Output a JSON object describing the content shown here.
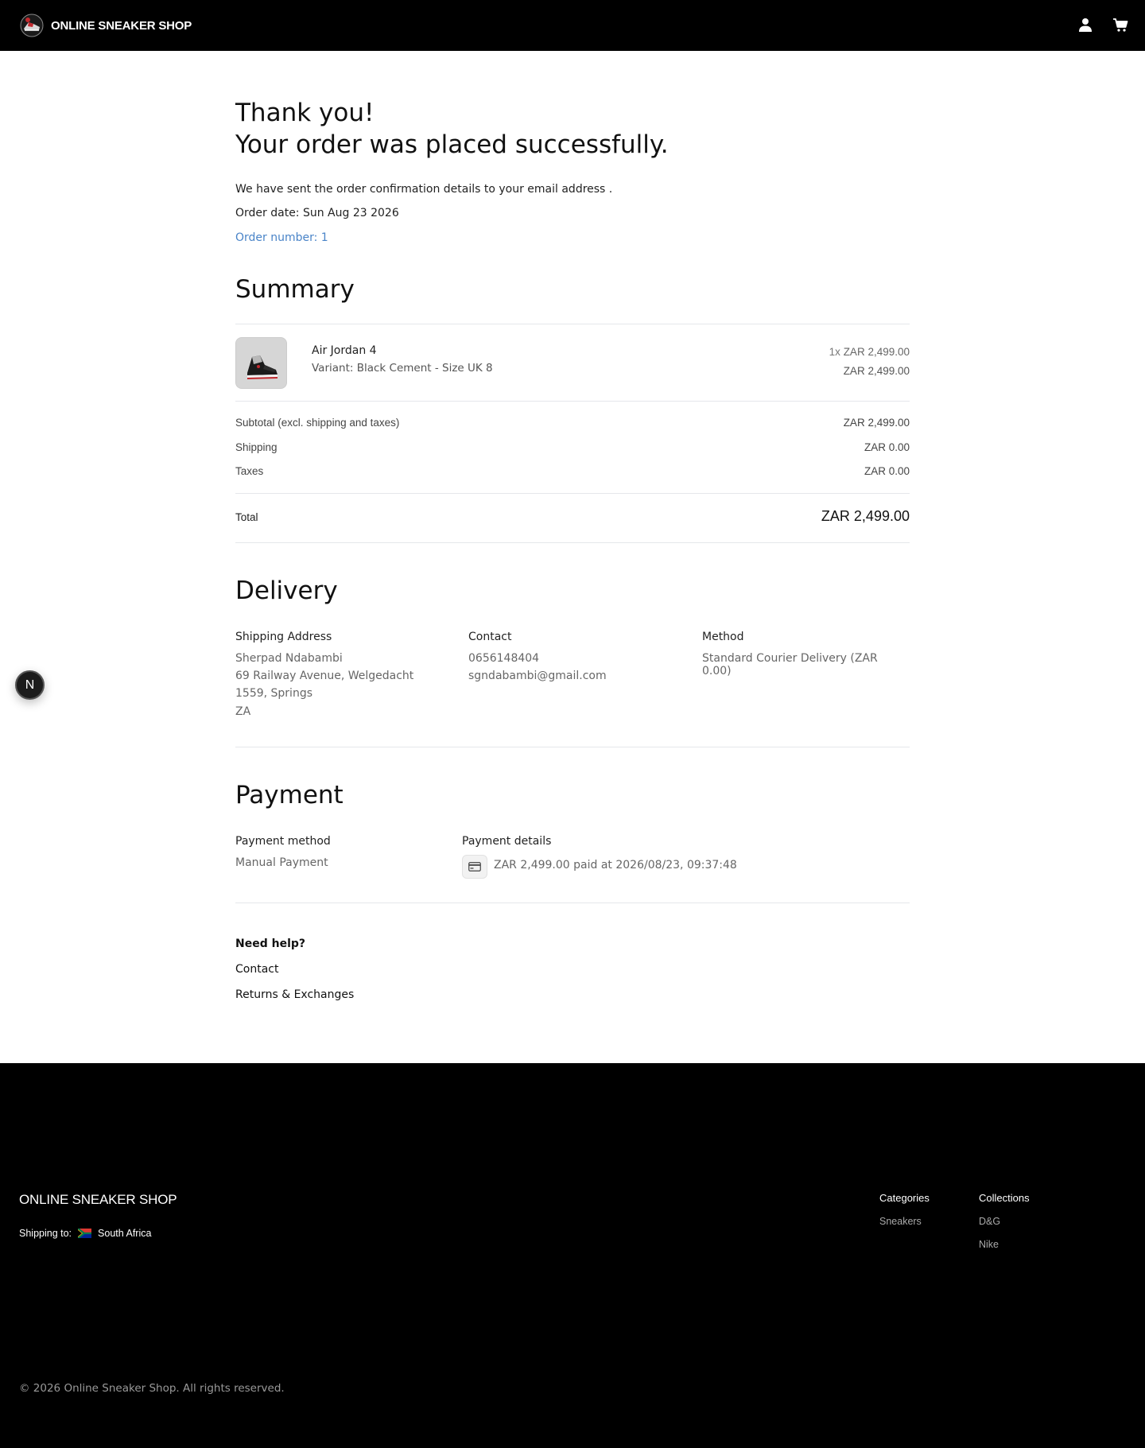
{
  "header": {
    "brand_name": "ONLINE SNEAKER SHOP",
    "logo_icon": "sneaker-logo-icon",
    "account_icon": "user-icon",
    "cart_icon": "cart-icon"
  },
  "confirmation": {
    "thank_you": "Thank you!",
    "success_message": "Your order was placed successfully.",
    "email_notice": "We have sent the order confirmation details to your email address .",
    "order_date": "Order date: Sun Aug 23 2026",
    "order_number": "Order number: 1"
  },
  "summary": {
    "heading": "Summary",
    "item": {
      "name": "Air Jordan 4",
      "variant": "Variant: Black Cement - Size UK 8",
      "quantity": "1x",
      "unit_price": "ZAR 2,499.00",
      "line_total": "ZAR 2,499.00"
    },
    "subtotal_label": "Subtotal (excl. shipping and taxes)",
    "subtotal_value": "ZAR 2,499.00",
    "shipping_label": "Shipping",
    "shipping_value": "ZAR 0.00",
    "taxes_label": "Taxes",
    "taxes_value": "ZAR 0.00",
    "total_label": "Total",
    "total_value": "ZAR 2,499.00"
  },
  "delivery": {
    "heading": "Delivery",
    "address_title": "Shipping Address",
    "address_lines": [
      "Sherpad Ndabambi",
      "69 Railway Avenue, Welgedacht",
      "1559, Springs",
      "ZA"
    ],
    "contact_title": "Contact",
    "contact_lines": [
      "0656148404",
      "sgndabambi@gmail.com"
    ],
    "method_title": "Method",
    "method_value": "Standard Courier Delivery (ZAR 0.00)"
  },
  "payment": {
    "heading": "Payment",
    "method_title": "Payment method",
    "method_value": "Manual Payment",
    "details_title": "Payment details",
    "details_value": "ZAR 2,499.00 paid at 2026/08/23, 09:37:48",
    "details_icon": "credit-card-icon"
  },
  "help": {
    "title": "Need help?",
    "links": [
      "Contact",
      "Returns & Exchanges"
    ]
  },
  "floating_badge": "N",
  "footer": {
    "brand_name": "ONLINE SNEAKER SHOP",
    "shipping_label": "Shipping to:",
    "shipping_country": "South Africa",
    "categories_title": "Categories",
    "categories": [
      "Sneakers"
    ],
    "collections_title": "Collections",
    "collections": [
      "D&G",
      "Nike"
    ],
    "copyright": "© 2026 Online Sneaker Shop. All rights reserved."
  }
}
